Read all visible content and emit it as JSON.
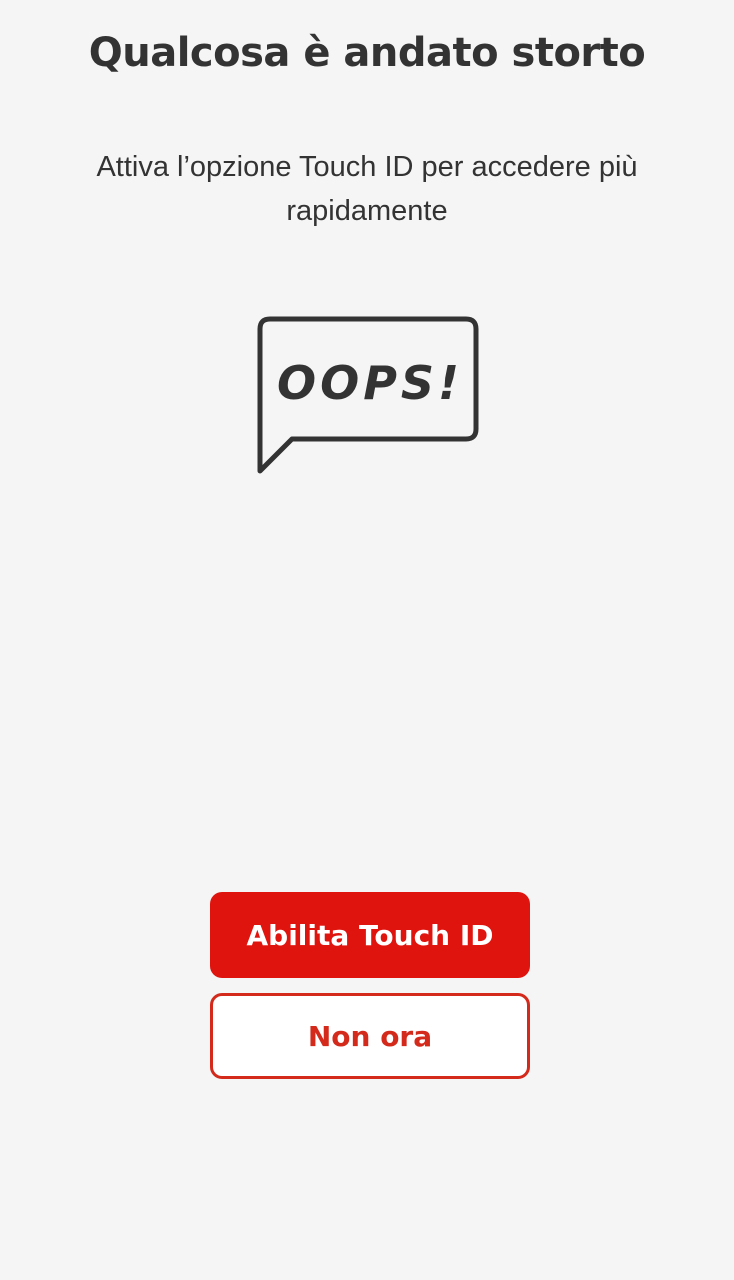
{
  "screen": {
    "title": "Qualcosa è andato storto",
    "message": "Attiva l’opzione Touch ID per accedere più rapidamente"
  },
  "illustration": {
    "icon": "speech-bubble-icon",
    "text": "OOPS!"
  },
  "actions": {
    "primary_label": "Abilita Touch ID",
    "secondary_label": "Non ora"
  },
  "colors": {
    "background": "#f5f5f5",
    "text": "#333333",
    "primary_button": "#e0140f",
    "secondary_border": "#d42a1c"
  }
}
